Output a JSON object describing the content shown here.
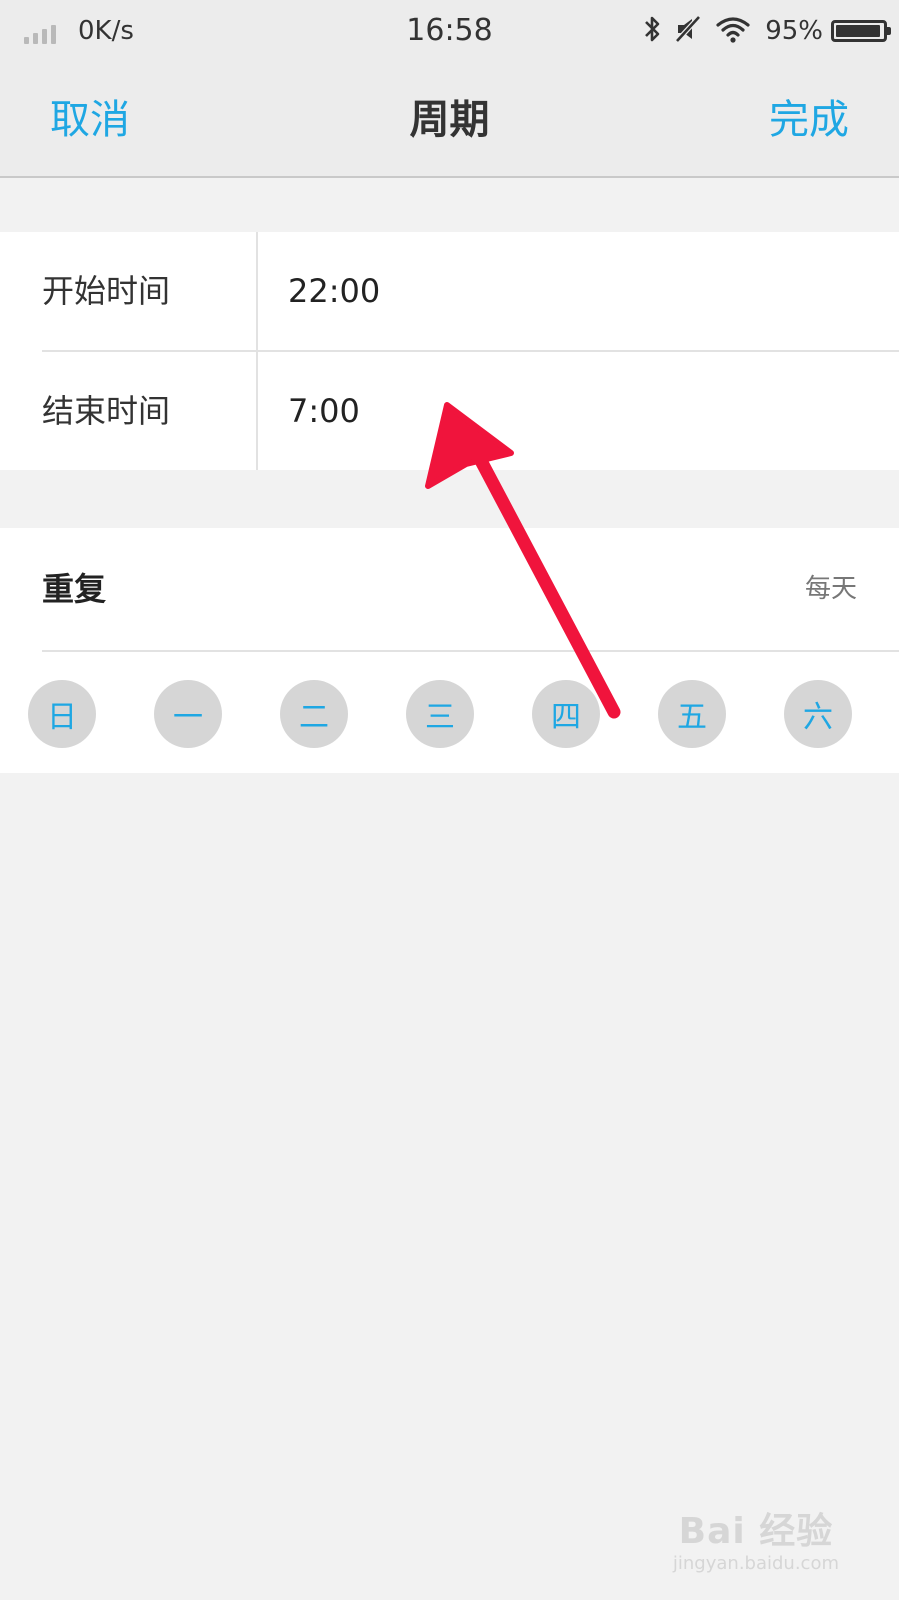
{
  "status_bar": {
    "network_speed": "0K/s",
    "time": "16:58",
    "battery_percent": "95%",
    "battery_level": 0.95,
    "icons": [
      "signal-icon",
      "bluetooth-icon",
      "silent-icon",
      "wifi-icon",
      "battery-icon"
    ]
  },
  "nav": {
    "cancel_label": "取消",
    "title": "周期",
    "done_label": "完成"
  },
  "schedule": {
    "start_label": "开始时间",
    "start_value": "22:00",
    "end_label": "结束时间",
    "end_value": "7:00"
  },
  "repeat": {
    "label": "重复",
    "value": "每天",
    "days": [
      "日",
      "一",
      "二",
      "三",
      "四",
      "五",
      "六"
    ]
  },
  "colors": {
    "accent": "#1fa7e3",
    "background": "#f2f2f2",
    "card": "#ffffff",
    "day_circle": "#d6d6d6",
    "arrow": "#f0143c"
  },
  "watermark": {
    "main": "Bai 经验",
    "sub": "jingyan.baidu.com"
  }
}
